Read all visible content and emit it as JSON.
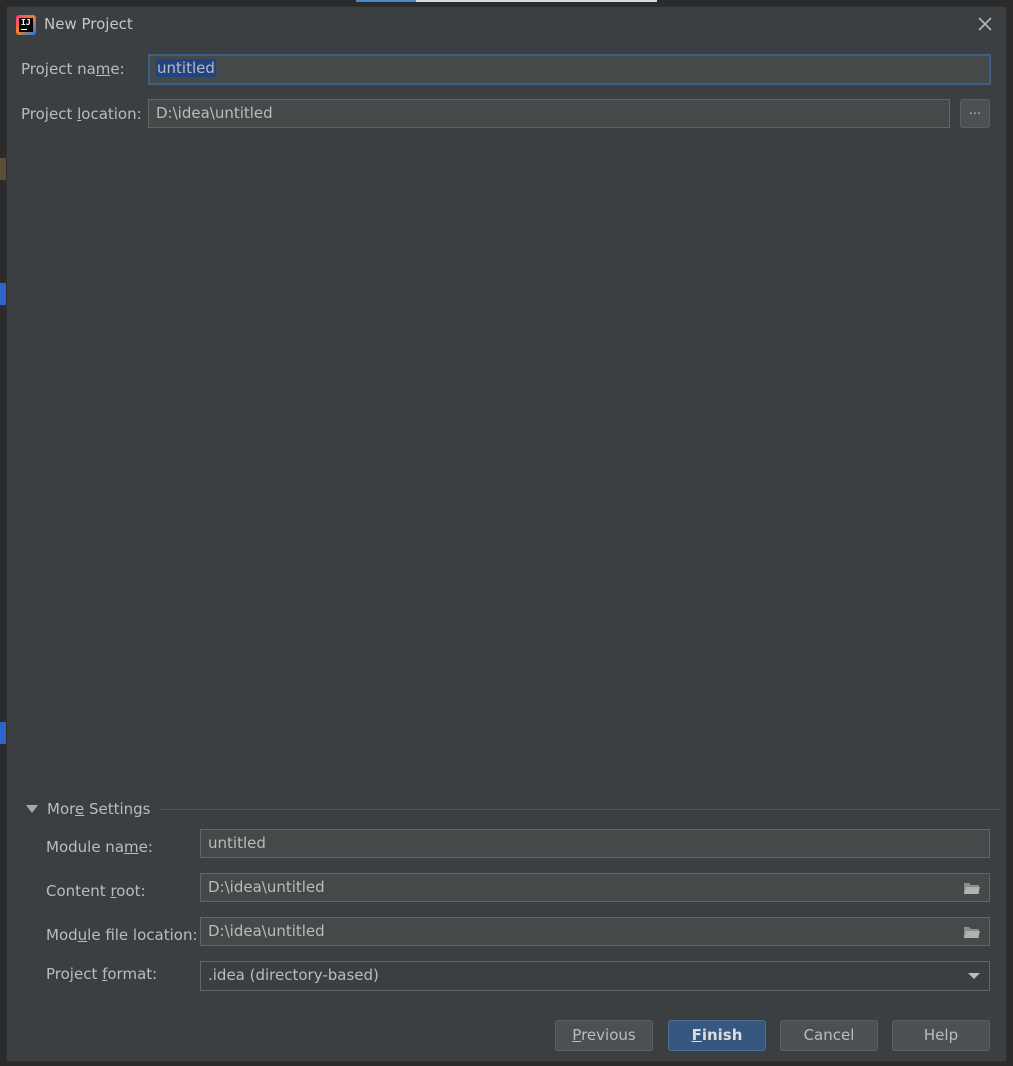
{
  "dialog": {
    "title": "New Project"
  },
  "project_name": {
    "label": "Project name:",
    "value": "untitled"
  },
  "project_location": {
    "label": "Project location:",
    "value": "D:\\idea\\untitled",
    "browse_label": "..."
  },
  "more_settings": {
    "label": "More Settings",
    "expanded": true,
    "module_name": {
      "label": "Module name:",
      "value": "untitled"
    },
    "content_root": {
      "label": "Content root:",
      "value": "D:\\idea\\untitled"
    },
    "module_file_location": {
      "label": "Module file location:",
      "value": "D:\\idea\\untitled"
    },
    "project_format": {
      "label": "Project format:",
      "value": ".idea (directory-based)"
    }
  },
  "buttons": {
    "previous": "Previous",
    "finish": "Finish",
    "cancel": "Cancel",
    "help": "Help"
  },
  "icons": {
    "app": "intellij-idea-icon",
    "close": "close-icon",
    "folder": "folder-icon",
    "expand": "triangle-down-icon",
    "dropdown": "chevron-down-icon"
  },
  "colors": {
    "dialog_bg": "#3c3f41",
    "field_bg": "#45494a",
    "focus_border": "#3d6185",
    "selection": "#214283",
    "primary_button": "#365880"
  }
}
